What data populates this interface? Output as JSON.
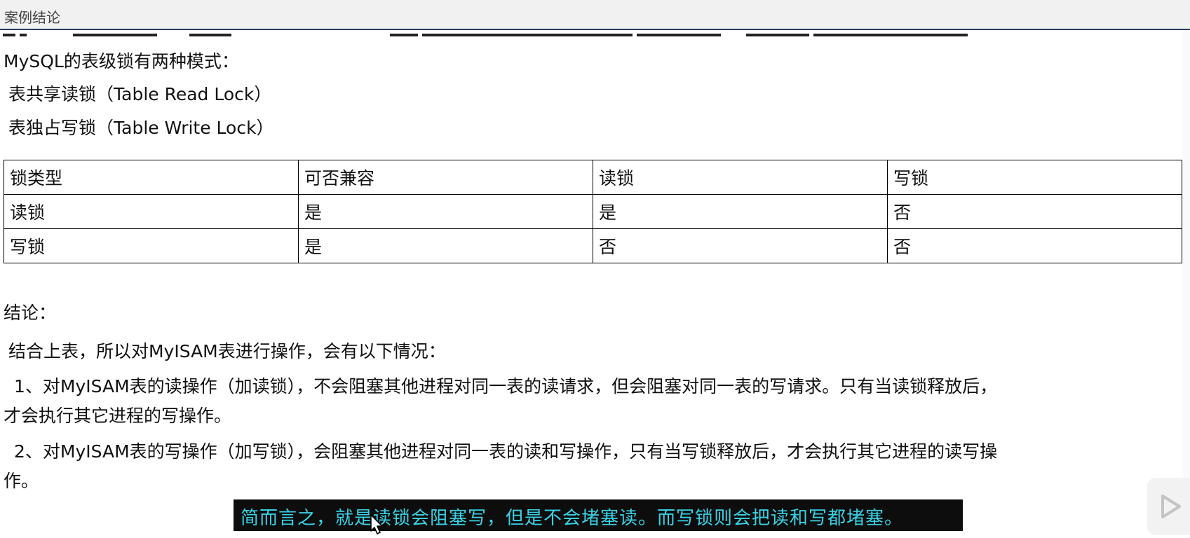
{
  "header": {
    "title": "案例结论"
  },
  "intro": {
    "heading": "MySQL的表级锁有两种模式：",
    "mode1": "表共享读锁（Table Read Lock）",
    "mode2": "表独占写锁（Table Write Lock）"
  },
  "table": {
    "headers": [
      "锁类型",
      "可否兼容",
      "读锁",
      "写锁"
    ],
    "rows": [
      [
        "读锁",
        "是",
        "是",
        "否"
      ],
      [
        "写锁",
        "是",
        "否",
        "否"
      ]
    ]
  },
  "conclusion": {
    "title": "结论：",
    "lead": "结合上表，所以对MyISAM表进行操作，会有以下情况：",
    "point1_line1": "1、对MyISAM表的读操作（加读锁），不会阻塞其他进程对同一表的读请求，但会阻塞对同一表的写请求。只有当读锁释放后，",
    "point1_line2": "才会执行其它进程的写操作。",
    "point2_line1": "2、对MyISAM表的写操作（加写锁），会阻塞其他进程对同一表的读和写操作，只有当写锁释放后，才会执行其它进程的读写操",
    "point2_line2": "作。"
  },
  "subtitle": {
    "text": "简而言之，就是读锁会阻塞写，但是不会堵塞读。而写锁则会把读和写都堵塞。"
  },
  "colors": {
    "header_border": "#2b3e63",
    "subtitle_text": "#39d2e6",
    "subtitle_bg": "#0d0d0d"
  },
  "icons": {
    "cursor": "mouse-cursor-icon",
    "play": "play-icon"
  }
}
